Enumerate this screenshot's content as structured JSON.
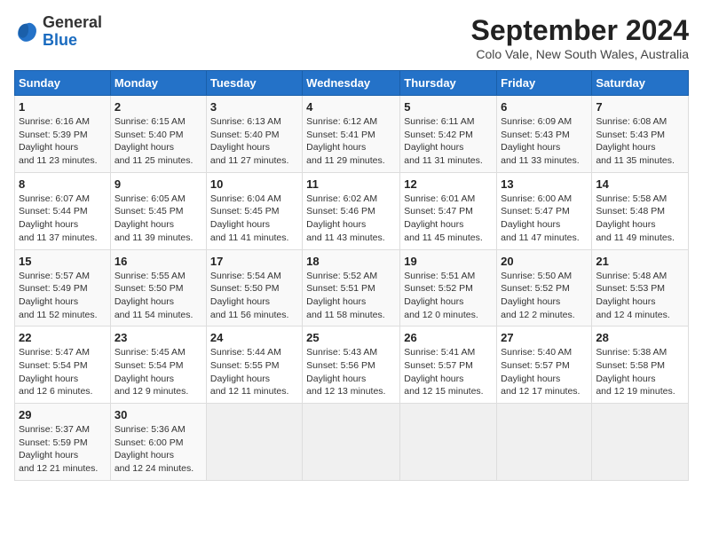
{
  "header": {
    "logo": {
      "general": "General",
      "blue": "Blue"
    },
    "title": "September 2024",
    "location": "Colo Vale, New South Wales, Australia"
  },
  "calendar": {
    "days_of_week": [
      "Sunday",
      "Monday",
      "Tuesday",
      "Wednesday",
      "Thursday",
      "Friday",
      "Saturday"
    ],
    "weeks": [
      [
        null,
        {
          "day": "2",
          "sunrise": "6:15 AM",
          "sunset": "5:40 PM",
          "daylight": "11 hours and 25 minutes."
        },
        {
          "day": "3",
          "sunrise": "6:13 AM",
          "sunset": "5:40 PM",
          "daylight": "11 hours and 27 minutes."
        },
        {
          "day": "4",
          "sunrise": "6:12 AM",
          "sunset": "5:41 PM",
          "daylight": "11 hours and 29 minutes."
        },
        {
          "day": "5",
          "sunrise": "6:11 AM",
          "sunset": "5:42 PM",
          "daylight": "11 hours and 31 minutes."
        },
        {
          "day": "6",
          "sunrise": "6:09 AM",
          "sunset": "5:43 PM",
          "daylight": "11 hours and 33 minutes."
        },
        {
          "day": "7",
          "sunrise": "6:08 AM",
          "sunset": "5:43 PM",
          "daylight": "11 hours and 35 minutes."
        }
      ],
      [
        {
          "day": "1",
          "sunrise": "6:16 AM",
          "sunset": "5:39 PM",
          "daylight": "11 hours and 23 minutes."
        },
        null,
        null,
        null,
        null,
        null,
        null
      ],
      [
        {
          "day": "8",
          "sunrise": "6:07 AM",
          "sunset": "5:44 PM",
          "daylight": "11 hours and 37 minutes."
        },
        {
          "day": "9",
          "sunrise": "6:05 AM",
          "sunset": "5:45 PM",
          "daylight": "11 hours and 39 minutes."
        },
        {
          "day": "10",
          "sunrise": "6:04 AM",
          "sunset": "5:45 PM",
          "daylight": "11 hours and 41 minutes."
        },
        {
          "day": "11",
          "sunrise": "6:02 AM",
          "sunset": "5:46 PM",
          "daylight": "11 hours and 43 minutes."
        },
        {
          "day": "12",
          "sunrise": "6:01 AM",
          "sunset": "5:47 PM",
          "daylight": "11 hours and 45 minutes."
        },
        {
          "day": "13",
          "sunrise": "6:00 AM",
          "sunset": "5:47 PM",
          "daylight": "11 hours and 47 minutes."
        },
        {
          "day": "14",
          "sunrise": "5:58 AM",
          "sunset": "5:48 PM",
          "daylight": "11 hours and 49 minutes."
        }
      ],
      [
        {
          "day": "15",
          "sunrise": "5:57 AM",
          "sunset": "5:49 PM",
          "daylight": "11 hours and 52 minutes."
        },
        {
          "day": "16",
          "sunrise": "5:55 AM",
          "sunset": "5:50 PM",
          "daylight": "11 hours and 54 minutes."
        },
        {
          "day": "17",
          "sunrise": "5:54 AM",
          "sunset": "5:50 PM",
          "daylight": "11 hours and 56 minutes."
        },
        {
          "day": "18",
          "sunrise": "5:52 AM",
          "sunset": "5:51 PM",
          "daylight": "11 hours and 58 minutes."
        },
        {
          "day": "19",
          "sunrise": "5:51 AM",
          "sunset": "5:52 PM",
          "daylight": "12 hours and 0 minutes."
        },
        {
          "day": "20",
          "sunrise": "5:50 AM",
          "sunset": "5:52 PM",
          "daylight": "12 hours and 2 minutes."
        },
        {
          "day": "21",
          "sunrise": "5:48 AM",
          "sunset": "5:53 PM",
          "daylight": "12 hours and 4 minutes."
        }
      ],
      [
        {
          "day": "22",
          "sunrise": "5:47 AM",
          "sunset": "5:54 PM",
          "daylight": "12 hours and 6 minutes."
        },
        {
          "day": "23",
          "sunrise": "5:45 AM",
          "sunset": "5:54 PM",
          "daylight": "12 hours and 9 minutes."
        },
        {
          "day": "24",
          "sunrise": "5:44 AM",
          "sunset": "5:55 PM",
          "daylight": "12 hours and 11 minutes."
        },
        {
          "day": "25",
          "sunrise": "5:43 AM",
          "sunset": "5:56 PM",
          "daylight": "12 hours and 13 minutes."
        },
        {
          "day": "26",
          "sunrise": "5:41 AM",
          "sunset": "5:57 PM",
          "daylight": "12 hours and 15 minutes."
        },
        {
          "day": "27",
          "sunrise": "5:40 AM",
          "sunset": "5:57 PM",
          "daylight": "12 hours and 17 minutes."
        },
        {
          "day": "28",
          "sunrise": "5:38 AM",
          "sunset": "5:58 PM",
          "daylight": "12 hours and 19 minutes."
        }
      ],
      [
        {
          "day": "29",
          "sunrise": "5:37 AM",
          "sunset": "5:59 PM",
          "daylight": "12 hours and 21 minutes."
        },
        {
          "day": "30",
          "sunrise": "5:36 AM",
          "sunset": "6:00 PM",
          "daylight": "12 hours and 24 minutes."
        },
        null,
        null,
        null,
        null,
        null
      ]
    ]
  },
  "labels": {
    "sunrise": "Sunrise:",
    "sunset": "Sunset:",
    "daylight": "Daylight:"
  }
}
